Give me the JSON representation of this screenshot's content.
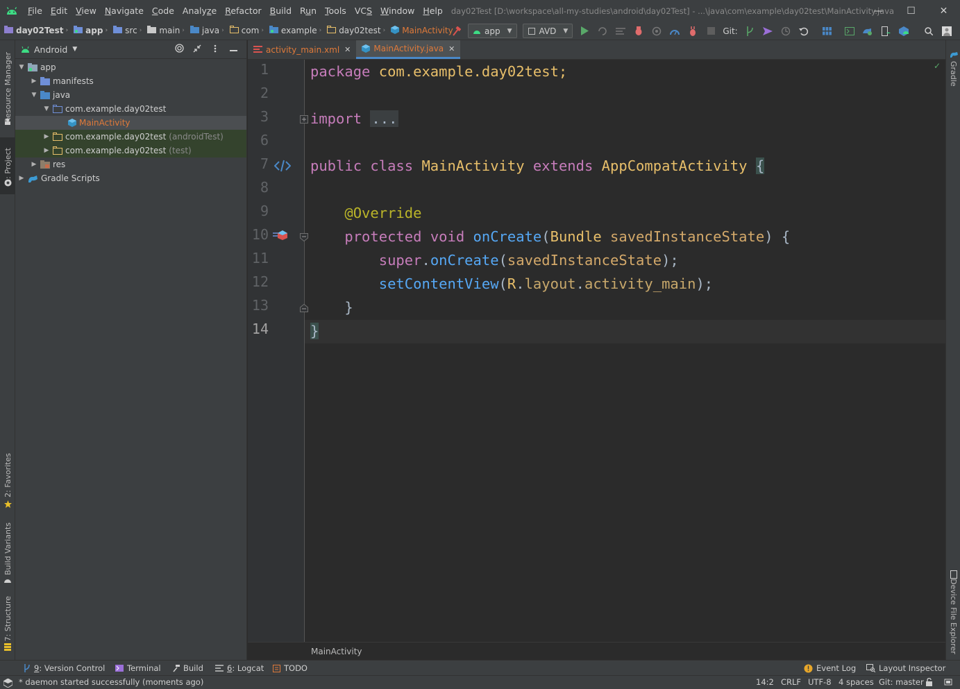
{
  "menu": {
    "items": [
      {
        "pre": "",
        "mn": "F",
        "post": "ile"
      },
      {
        "pre": "",
        "mn": "E",
        "post": "dit"
      },
      {
        "pre": "",
        "mn": "V",
        "post": "iew"
      },
      {
        "pre": "",
        "mn": "N",
        "post": "avigate"
      },
      {
        "pre": "",
        "mn": "C",
        "post": "ode"
      },
      {
        "pre": "Analy",
        "mn": "z",
        "post": "e"
      },
      {
        "pre": "",
        "mn": "R",
        "post": "efactor"
      },
      {
        "pre": "",
        "mn": "B",
        "post": "uild"
      },
      {
        "pre": "R",
        "mn": "u",
        "post": "n"
      },
      {
        "pre": "",
        "mn": "T",
        "post": "ools"
      },
      {
        "pre": "VC",
        "mn": "S",
        "post": ""
      },
      {
        "pre": "",
        "mn": "W",
        "post": "indow"
      },
      {
        "pre": "",
        "mn": "H",
        "post": "elp"
      }
    ],
    "window_title": "day02Test [D:\\workspace\\all-my-studies\\android\\day02Test] - ...\\java\\com\\example\\day02test\\MainActivity.java"
  },
  "window_controls": {
    "minimize": "—",
    "maximize": "☐",
    "close": "✕"
  },
  "breadcrumbs": [
    {
      "label": "day02Test",
      "icon": "project-folder-icon"
    },
    {
      "label": "app",
      "icon": "module-folder-icon"
    },
    {
      "label": "src",
      "icon": "folder-icon"
    },
    {
      "label": "main",
      "icon": "folder-icon"
    },
    {
      "label": "java",
      "icon": "source-folder-icon"
    },
    {
      "label": "com",
      "icon": "package-icon"
    },
    {
      "label": "example",
      "icon": "package-icon"
    },
    {
      "label": "day02test",
      "icon": "package-icon"
    },
    {
      "label": "MainActivity",
      "icon": "java-class-icon"
    }
  ],
  "toolbar": {
    "run_config": "app",
    "device": "AVD",
    "git_label": "Git:"
  },
  "left_stripe": {
    "resource_manager": "Resource Manager",
    "project": "1: Project",
    "favorites": "2: Favorites",
    "build_variants": "Build Variants",
    "structure": "7: Structure"
  },
  "right_stripe": {
    "gradle": "Gradle",
    "device_file_explorer": "Device File Explorer"
  },
  "project_panel": {
    "view_mode": "Android",
    "tree": [
      {
        "label": "app",
        "sub": "",
        "level": 0,
        "arrow": "▼"
      },
      {
        "label": "manifests",
        "sub": "",
        "level": 1,
        "arrow": "▶"
      },
      {
        "label": "java",
        "sub": "",
        "level": 1,
        "arrow": "▼"
      },
      {
        "label": "com.example.day02test",
        "sub": "",
        "level": 2,
        "arrow": "▼"
      },
      {
        "label": "MainActivity",
        "sub": "",
        "level": 3,
        "arrow": ""
      },
      {
        "label": "com.example.day02test",
        "sub": "(androidTest)",
        "level": 2,
        "arrow": "▶"
      },
      {
        "label": "com.example.day02test",
        "sub": "(test)",
        "level": 2,
        "arrow": "▶"
      },
      {
        "label": "res",
        "sub": "",
        "level": 1,
        "arrow": "▶"
      },
      {
        "label": "Gradle Scripts",
        "sub": "",
        "level": 0,
        "arrow": "▶"
      }
    ]
  },
  "editor": {
    "tabs": [
      {
        "label": "activity_main.xml",
        "close": "✕"
      },
      {
        "label": "MainActivity.java",
        "close": "✕"
      }
    ],
    "line_numbers": [
      "1",
      "2",
      "3",
      "6",
      "7",
      "8",
      "9",
      "10",
      "11",
      "12",
      "13",
      "14"
    ],
    "code": {
      "l1_kw": "package",
      "l1_rest": " com.example.day02test;",
      "l3_kw": "import",
      "l3_fold": "...",
      "l7_public": "public",
      "l7_class": "class",
      "l7_name": "MainActivity",
      "l7_extends": "extends",
      "l7_parent": "AppCompatActivity",
      "l7_brace": "{",
      "l9_ann": "@Override",
      "l10_protected": "protected",
      "l10_void": "void",
      "l10_method": "onCreate",
      "l10_open": "(",
      "l10_type": "Bundle",
      "l10_param": "savedInstanceState",
      "l10_close": ") {",
      "l11_super": "super",
      "l11_dot": ".",
      "l11_method": "onCreate",
      "l11_open": "(",
      "l11_param": "savedInstanceState",
      "l11_close": ");",
      "l12_method": "setContentView",
      "l12_open": "(",
      "l12_r": "R",
      "l12_dot1": ".",
      "l12_layout": "layout",
      "l12_dot2": ".",
      "l12_name": "activity_main",
      "l12_close": ");",
      "l13_brace": "}",
      "l14_brace": "}"
    },
    "breadcrumb": "MainActivity",
    "check_mark": "✓"
  },
  "bottom_tools": [
    {
      "mn": "9",
      "post": ": Version Control"
    },
    {
      "mn": "",
      "post": "Terminal"
    },
    {
      "mn": "",
      "post": "Build"
    },
    {
      "mn": "6",
      "post": ": Logcat"
    },
    {
      "mn": "",
      "post": "TODO"
    }
  ],
  "bottom_right_tools": {
    "event_log": "Event Log",
    "layout_inspector": "Layout Inspector"
  },
  "status": {
    "message": "* daemon started successfully (moments ago)",
    "position": "14:2",
    "line_sep": "CRLF",
    "encoding": "UTF-8",
    "indent": "4 spaces",
    "vcs": "Git: master"
  }
}
